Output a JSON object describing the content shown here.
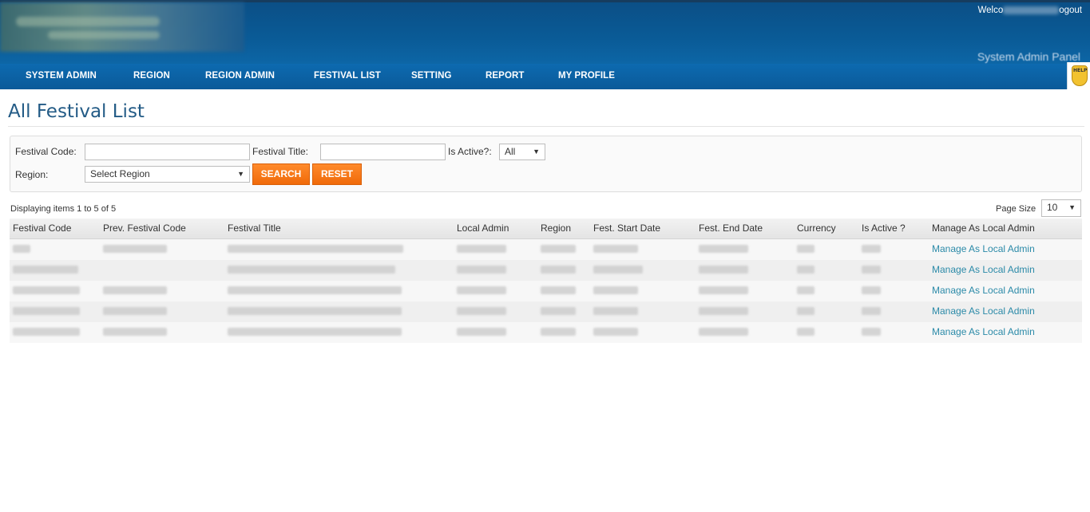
{
  "header": {
    "welcome_prefix": "Welco",
    "logout_label": "ogout",
    "panel_title": "System Admin Panel"
  },
  "nav": {
    "items": [
      {
        "label": "SYSTEM ADMIN"
      },
      {
        "label": "REGION"
      },
      {
        "label": "REGION ADMIN"
      },
      {
        "label": "FESTIVAL LIST"
      },
      {
        "label": "SETTING"
      },
      {
        "label": "REPORT"
      },
      {
        "label": "MY PROFILE"
      }
    ]
  },
  "help_badge": "HELP",
  "page": {
    "title": "All Festival List"
  },
  "filters": {
    "festival_code_label": "Festival Code:",
    "festival_code_value": "",
    "festival_title_label": "Festival Title:",
    "festival_title_value": "",
    "is_active_label": "Is Active?:",
    "is_active_value": "All",
    "region_label": "Region:",
    "region_value": "Select Region",
    "search_label": "SEARCH",
    "reset_label": "RESET"
  },
  "grid_info": {
    "displaying": "Displaying items 1 to 5 of 5",
    "page_size_label": "Page Size",
    "page_size_value": "10"
  },
  "table": {
    "columns": [
      "Festival Code",
      "Prev. Festival Code",
      "Festival Title",
      "Local Admin",
      "Region",
      "Fest. Start Date",
      "Fest. End Date",
      "Currency",
      "Is Active ?",
      "Manage As Local Admin"
    ],
    "rows": [
      {
        "action": "Manage As Local Admin"
      },
      {
        "action": "Manage As Local Admin"
      },
      {
        "action": "Manage As Local Admin"
      },
      {
        "action": "Manage As Local Admin"
      },
      {
        "action": "Manage As Local Admin"
      }
    ]
  },
  "colors": {
    "header_bg": "#0b4f86",
    "nav_bg": "#0a5b97",
    "title": "#235b86",
    "button": "#f47a1f",
    "link": "#2b8aa8"
  }
}
